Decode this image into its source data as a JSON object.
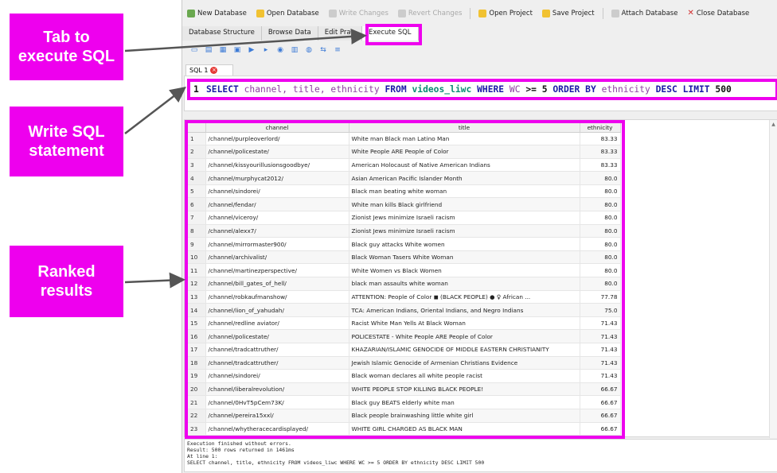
{
  "toolbar": {
    "buttons": [
      {
        "label": "New Database",
        "icon": "new-database-icon",
        "enabled": true
      },
      {
        "label": "Open Database",
        "icon": "open-database-icon",
        "enabled": true
      },
      {
        "label": "Write Changes",
        "icon": "write-changes-icon",
        "enabled": false
      },
      {
        "label": "Revert Changes",
        "icon": "revert-changes-icon",
        "enabled": false
      },
      {
        "label": "Open Project",
        "icon": "open-project-icon",
        "enabled": true
      },
      {
        "label": "Save Project",
        "icon": "save-project-icon",
        "enabled": true
      },
      {
        "label": "Attach Database",
        "icon": "attach-database-icon",
        "enabled": true
      },
      {
        "label": "Close Database",
        "icon": "close-database-icon",
        "enabled": true
      }
    ]
  },
  "tabs": [
    {
      "label": "Database Structure",
      "active": false
    },
    {
      "label": "Browse Data",
      "active": false
    },
    {
      "label": "Edit Prag",
      "active": false
    },
    {
      "label": "Execute SQL",
      "active": true
    }
  ],
  "editor": {
    "tab_label": "SQL 1",
    "line_number": "1",
    "sql_tokens": [
      {
        "t": "SELECT",
        "c": "kw"
      },
      {
        "t": " channel, title, ethnicity ",
        "c": "col"
      },
      {
        "t": "FROM",
        "c": "kw"
      },
      {
        "t": " videos_liwc ",
        "c": "tbl"
      },
      {
        "t": "WHERE",
        "c": "kw"
      },
      {
        "t": " WC ",
        "c": "col"
      },
      {
        "t": ">= 5 ",
        "c": "num"
      },
      {
        "t": "ORDER BY",
        "c": "kw"
      },
      {
        "t": " ethnicity ",
        "c": "col"
      },
      {
        "t": "DESC LIMIT",
        "c": "kw"
      },
      {
        "t": " 500",
        "c": "num"
      }
    ]
  },
  "results": {
    "columns": [
      "channel",
      "title",
      "ethnicity"
    ],
    "rows": [
      [
        "1",
        "/channel/purpleoverlord/",
        "White man Black man Latino Man",
        "83.33"
      ],
      [
        "2",
        "/channel/policestate/",
        "White People ARE People of Color",
        "83.33"
      ],
      [
        "3",
        "/channel/kissyourillusionsgoodbye/",
        "American Holocaust of Native American Indians",
        "83.33"
      ],
      [
        "4",
        "/channel/murphycat2012/",
        "Asian American Pacific Islander Month",
        "80.0"
      ],
      [
        "5",
        "/channel/sindorei/",
        "Black man beating white woman",
        "80.0"
      ],
      [
        "6",
        "/channel/fendar/",
        "White man kills Black girlfriend",
        "80.0"
      ],
      [
        "7",
        "/channel/viceroy/",
        "Zionist Jews minimize Israeli racism",
        "80.0"
      ],
      [
        "8",
        "/channel/alexx7/",
        "Zionist Jews minimize Israeli racism",
        "80.0"
      ],
      [
        "9",
        "/channel/mirrormaster900/",
        "Black guy attacks White women",
        "80.0"
      ],
      [
        "10",
        "/channel/archivalist/",
        "Black Woman Tasers White Woman",
        "80.0"
      ],
      [
        "11",
        "/channel/martinezperspective/",
        "White Women vs Black Women",
        "80.0"
      ],
      [
        "12",
        "/channel/bill_gates_of_hell/",
        "black man assaults white woman",
        "80.0"
      ],
      [
        "13",
        "/channel/robkaufmanshow/",
        "ATTENTION: People of Color ◼ (BLACK PEOPLE) ● ♀ African ...",
        "77.78"
      ],
      [
        "14",
        "/channel/lion_of_yahudah/",
        "TCA: American Indians, Oriental Indians, and Negro Indians",
        "75.0"
      ],
      [
        "15",
        "/channel/redline aviator/",
        "Racist White Man Yells At Black Woman",
        "71.43"
      ],
      [
        "16",
        "/channel/policestate/",
        "POLICESTATE - White People ARE People of Color",
        "71.43"
      ],
      [
        "17",
        "/channel/tradcattruther/",
        "KHAZARIAN/ISLAMIC GENOCIDE OF MIDDLE EASTERN CHRISTIANITY",
        "71.43"
      ],
      [
        "18",
        "/channel/tradcattruther/",
        "Jewish Islamic Genocide of Armenian Christians Evidence",
        "71.43"
      ],
      [
        "19",
        "/channel/sindorei/",
        "Black woman declares all white people racist",
        "71.43"
      ],
      [
        "20",
        "/channel/liberalrevolution/",
        "WHITE PEOPLE STOP KILLING BLACK PEOPLE!",
        "66.67"
      ],
      [
        "21",
        "/channel/0HvT5pCem73K/",
        "Black guy BEATS elderly white man",
        "66.67"
      ],
      [
        "22",
        "/channel/pereira15xxl/",
        "Black people brainwashing little white girl",
        "66.67"
      ],
      [
        "23",
        "/channel/whytheracecardisplayed/",
        "WHITE GIRL CHARGED AS BLACK MAN",
        "66.67"
      ]
    ]
  },
  "log": {
    "lines": [
      "Execution finished without errors.",
      "Result: 500 rows returned in 1461ms",
      "At line 1:",
      "SELECT channel, title, ethnicity FROM videos_liwc WHERE WC >= 5 ORDER BY ethnicity DESC LIMIT 500"
    ]
  },
  "annotations": {
    "tab_callout": "Tab to execute SQL",
    "write_callout": "Write SQL statement",
    "ranked_callout": "Ranked results",
    "accent_color": "#ee00ee"
  }
}
